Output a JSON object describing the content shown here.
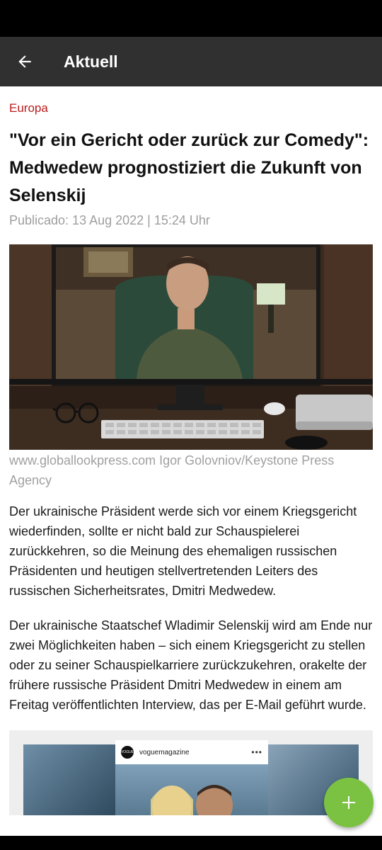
{
  "app_bar": {
    "title": "Aktuell",
    "back_icon": "arrow-left-icon"
  },
  "article": {
    "category": "Europa",
    "headline": "\"Vor ein Gericht oder zurück zur Comedy\": Medwedew prognostiziert die Zukunft von Selenskij",
    "published": "Publicado: 13 Aug 2022 | 15:24 Uhr",
    "image_caption": "www.globallookpress.com Igor Golovniov/Keystone Press Agency",
    "paragraphs": [
      "Der ukrainische Präsident werde sich vor einem Kriegsgericht wiederfinden, sollte er nicht bald zur Schauspielerei zurückkehren, so die Meinung des ehemaligen russischen Präsidenten und heutigen stellvertretenden Leiters des russischen Sicherheitsrates, Dmitri Medwedew.",
      "Der ukrainische Staatschef Wladimir Selenskij wird am Ende nur zwei Möglichkeiten haben – sich einem Kriegsgericht zu stellen oder zu seiner Schauspielkarriere zurückzukehren, orakelte der frühere russische Präsident Dmitri Medwedew in einem am Freitag veröffentlichten Interview, das per E-Mail geführt wurde."
    ]
  },
  "embed": {
    "avatar_text": "VOGUE",
    "username": "voguemagazine",
    "more_icon": "more-dots-icon"
  },
  "fab": {
    "icon": "plus-icon"
  },
  "colors": {
    "app_bar": "#303030",
    "category": "#b71c1c",
    "fab": "#7cc242"
  }
}
